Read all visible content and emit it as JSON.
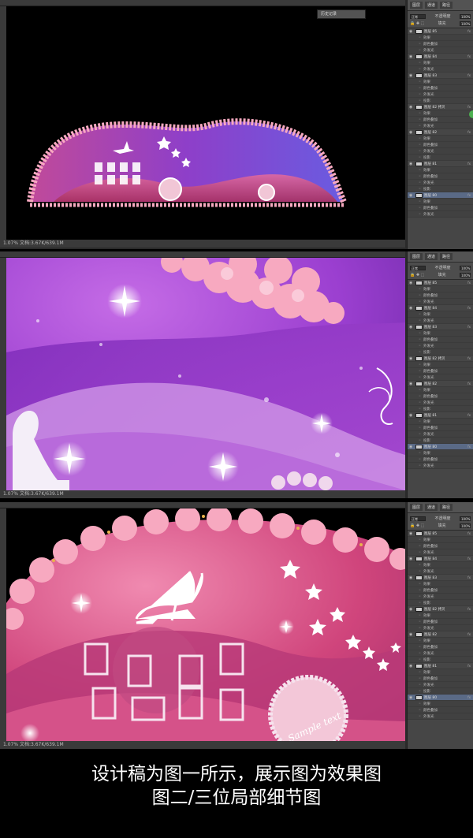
{
  "panels": [
    {
      "name": "design-draft-view",
      "status": "1.07%  文档:3.67K/639.1M",
      "history_label": "历史记录",
      "layer_tab_labels": [
        "图层",
        "通道",
        "路径"
      ],
      "opacity_label": "不透明度",
      "opacity_value": "100%",
      "fill_label": "填充",
      "fill_value": "100%",
      "normal_mode": "正常"
    },
    {
      "name": "detail-view-1",
      "status": "1.07%  文档:3.67K/639.1M",
      "layer_tab_labels": [
        "图层",
        "通道",
        "路径"
      ],
      "opacity_label": "不透明度",
      "opacity_value": "100%",
      "fill_label": "填充",
      "fill_value": "100%",
      "normal_mode": "正常"
    },
    {
      "name": "detail-view-2",
      "status": "1.07%  文档:3.67K/639.1M",
      "layer_tab_labels": [
        "图层",
        "通道",
        "路径"
      ],
      "opacity_label": "不透明度",
      "opacity_value": "100%",
      "fill_label": "填充",
      "fill_value": "100%",
      "normal_mode": "正常"
    }
  ],
  "layers": [
    {
      "label": "图层 85",
      "sub": false
    },
    {
      "label": "效果",
      "sub": true
    },
    {
      "label": "颜色叠加",
      "sub": true
    },
    {
      "label": "外发光",
      "sub": true
    },
    {
      "label": "图层 84",
      "sub": false
    },
    {
      "label": "效果",
      "sub": true
    },
    {
      "label": "外发光",
      "sub": true
    },
    {
      "label": "图层 83",
      "sub": false
    },
    {
      "label": "效果",
      "sub": true
    },
    {
      "label": "颜色叠加",
      "sub": true
    },
    {
      "label": "外发光",
      "sub": true
    },
    {
      "label": "投影",
      "sub": true
    },
    {
      "label": "图层 82 拷贝",
      "sub": false
    },
    {
      "label": "效果",
      "sub": true
    },
    {
      "label": "颜色叠加",
      "sub": true
    },
    {
      "label": "外发光",
      "sub": true
    },
    {
      "label": "图层 82",
      "sub": false
    },
    {
      "label": "效果",
      "sub": true
    },
    {
      "label": "颜色叠加",
      "sub": true
    },
    {
      "label": "外发光",
      "sub": true
    },
    {
      "label": "投影",
      "sub": true
    },
    {
      "label": "图层 81",
      "sub": false
    },
    {
      "label": "效果",
      "sub": true
    },
    {
      "label": "颜色叠加",
      "sub": true
    },
    {
      "label": "外发光",
      "sub": true
    },
    {
      "label": "投影",
      "sub": true
    },
    {
      "label": "图层 80",
      "sub": false
    },
    {
      "label": "效果",
      "sub": true
    },
    {
      "label": "颜色叠加",
      "sub": true
    },
    {
      "label": "外发光",
      "sub": true
    }
  ],
  "sample_text": "Sample text",
  "caption": {
    "line1": "设计稿为图一所示，展示图为效果图",
    "line2": "图二/三位局部细节图"
  },
  "colors": {
    "ps_dark": "#2b2b2b",
    "panel_gray": "#464646",
    "purple": "#9b3fd0",
    "pink": "#e0407a",
    "petal": "#f7a9c0"
  }
}
